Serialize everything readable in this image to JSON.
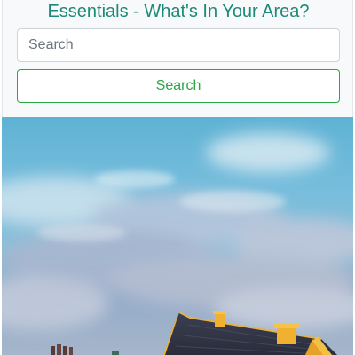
{
  "header": {
    "title": "Essentials - What's In Your Area?"
  },
  "search": {
    "placeholder": "Search",
    "value": "",
    "button_label": "Search"
  },
  "colors": {
    "title": "#1c8a78",
    "button_accent": "#28a745",
    "panel_background": "#f8f9fa"
  }
}
